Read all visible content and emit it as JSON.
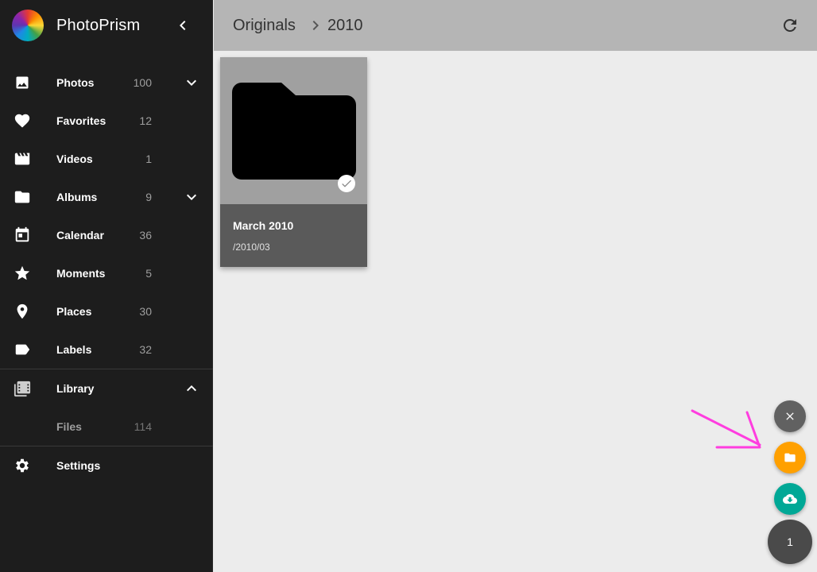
{
  "app": {
    "name": "PhotoPrism"
  },
  "sidebar": {
    "items": [
      {
        "label": "Photos",
        "count": "100",
        "icon": "image-icon",
        "expand": "down"
      },
      {
        "label": "Favorites",
        "count": "12",
        "icon": "heart-icon"
      },
      {
        "label": "Videos",
        "count": "1",
        "icon": "movie-icon"
      },
      {
        "label": "Albums",
        "count": "9",
        "icon": "folder-icon",
        "expand": "down"
      },
      {
        "label": "Calendar",
        "count": "36",
        "icon": "calendar-icon"
      },
      {
        "label": "Moments",
        "count": "5",
        "icon": "star-icon"
      },
      {
        "label": "Places",
        "count": "30",
        "icon": "place-icon"
      },
      {
        "label": "Labels",
        "count": "32",
        "icon": "label-icon"
      },
      {
        "label": "Library",
        "icon": "library-icon",
        "expand": "up"
      },
      {
        "label": "Files",
        "count": "114"
      },
      {
        "label": "Settings",
        "icon": "gear-icon"
      }
    ]
  },
  "toolbar": {
    "breadcrumb_root": "Originals",
    "breadcrumb_current": "2010"
  },
  "folders": [
    {
      "title": "March 2010",
      "path": "/2010/03",
      "selected": true
    }
  ],
  "fab": {
    "selection_count": "1"
  },
  "colors": {
    "sidebar_bg": "#1d1d1d",
    "toolbar_bg": "#b5b5b5",
    "content_bg": "#ececec",
    "fab_folder": "#ffa000",
    "fab_download": "#00a896",
    "annotation": "#ff3ddf"
  }
}
